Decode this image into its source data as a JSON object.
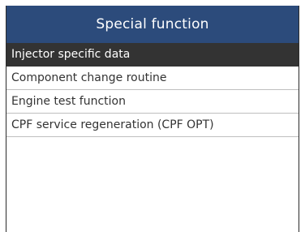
{
  "header": {
    "title": "Special function"
  },
  "menu": {
    "items": [
      {
        "label": "Injector specific data"
      },
      {
        "label": "Component change routine"
      },
      {
        "label": "Engine test function"
      },
      {
        "label": "CPF service regeneration (CPF OPT)"
      }
    ],
    "selected_index": 0
  },
  "colors": {
    "header_bg": "#2c4b7b",
    "selected_bg": "#333333"
  }
}
